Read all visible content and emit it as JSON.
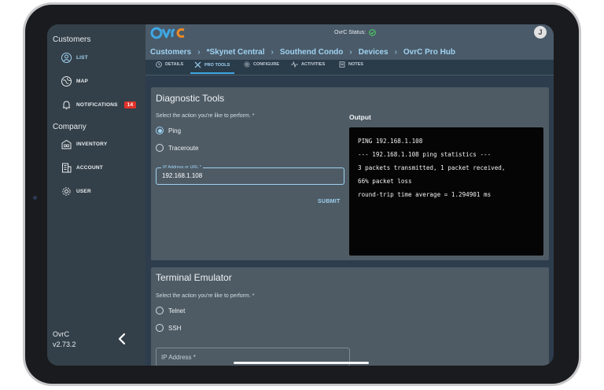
{
  "app": {
    "status_label": "OvrC Status:",
    "status_color": "#4cd964",
    "avatar_initial": "J",
    "accent_color": "#9fd2f2",
    "brand_colors": [
      "#3fa7e4",
      "#f08a24"
    ]
  },
  "sidebar": {
    "customers_section": "Customers",
    "company_section": "Company",
    "items": [
      {
        "label": "LIST",
        "icon": "person-icon"
      },
      {
        "label": "MAP",
        "icon": "globe-icon"
      },
      {
        "label": "NOTIFICATIONS",
        "icon": "bell-icon",
        "badge": "14"
      },
      {
        "label": "INVENTORY",
        "icon": "warehouse-icon"
      },
      {
        "label": "ACCOUNT",
        "icon": "building-icon"
      },
      {
        "label": "USER",
        "icon": "gear-icon"
      }
    ],
    "footer_app": "OvrC",
    "footer_version": "v2.73.2"
  },
  "breadcrumb": [
    "Customers",
    "*Skynet Central",
    "Southend Condo",
    "Devices",
    "OvrC Pro Hub"
  ],
  "tabs": [
    {
      "label": "DETAILS",
      "icon": "clock-icon"
    },
    {
      "label": "PRO TOOLS",
      "icon": "tools-icon",
      "active": true
    },
    {
      "label": "CONFIGURE",
      "icon": "gear-icon"
    },
    {
      "label": "ACTIVITIES",
      "icon": "pulse-icon"
    },
    {
      "label": "NOTES",
      "icon": "notes-icon"
    }
  ],
  "diagnostic": {
    "title": "Diagnostic Tools",
    "instructions": "Select the action you're like to perform. *",
    "options": [
      "Ping",
      "Traceroute"
    ],
    "selected": "Ping",
    "ip_label": "IP Address or URL *",
    "ip_value": "192.168.1.108",
    "submit_label": "SUBMIT",
    "output_label": "Output",
    "output_lines": [
      "PING 192.168.1.108",
      "--- 192.168.1.108 ping statistics ---",
      "3 packets transmitted, 1 packet received,",
      "66% packet loss",
      "round-trip time average = 1.294901 ms"
    ]
  },
  "terminal": {
    "title": "Terminal Emulator",
    "instructions": "Select the action you're like to perform. *",
    "options": [
      "Telnet",
      "SSH"
    ],
    "ip_placeholder": "IP Address *"
  }
}
